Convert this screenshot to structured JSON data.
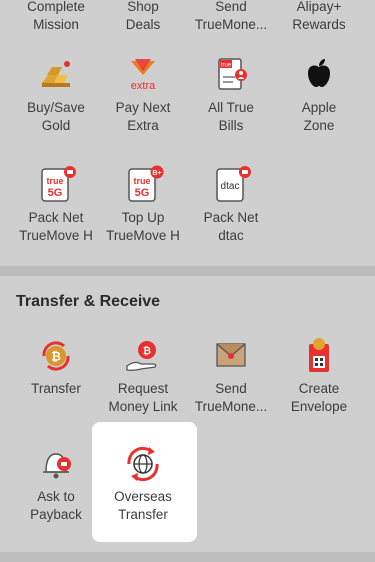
{
  "top_row": [
    {
      "label": "Complete\nMission"
    },
    {
      "label": "Shop\nDeals"
    },
    {
      "label": "Send\nTrueMone..."
    },
    {
      "label": "Alipay+\nRewards"
    }
  ],
  "row2": [
    {
      "label": "Buy/Save\nGold",
      "icon": "gold-bars-icon"
    },
    {
      "label": "Pay Next\nExtra",
      "icon": "extra-logo-icon",
      "icon_text": "extra"
    },
    {
      "label": "All True\nBills",
      "icon": "bill-icon",
      "icon_text": "true"
    },
    {
      "label": "Apple\nZone",
      "icon": "apple-icon"
    }
  ],
  "row3": [
    {
      "label": "Pack Net\nTrueMove H",
      "icon": "true5g-sim-icon",
      "icon_text": "true",
      "icon_sub": "5G"
    },
    {
      "label": "Top Up\nTrueMove H",
      "icon": "true5g-topup-icon",
      "icon_text": "true",
      "icon_sub": "5G",
      "badge": "B+"
    },
    {
      "label": "Pack Net\ndtac",
      "icon": "dtac-sim-icon",
      "icon_text": "dtac"
    }
  ],
  "transfer_section": {
    "title": "Transfer & Receive",
    "items": [
      {
        "label": "Transfer",
        "icon": "coin-transfer-icon"
      },
      {
        "label": "Request\nMoney Link",
        "icon": "request-money-icon"
      },
      {
        "label": "Send\nTrueMone...",
        "icon": "envelope-icon"
      },
      {
        "label": "Create\nEnvelope",
        "icon": "red-envelope-icon"
      }
    ],
    "items2": [
      {
        "label": "Ask to\nPayback",
        "icon": "payback-bell-icon"
      },
      {
        "label": "Overseas\nTransfer",
        "icon": "globe-transfer-icon"
      }
    ]
  },
  "colors": {
    "accent": "#e8312f",
    "gold": "#e0a530",
    "background": "#d6d6d6"
  }
}
